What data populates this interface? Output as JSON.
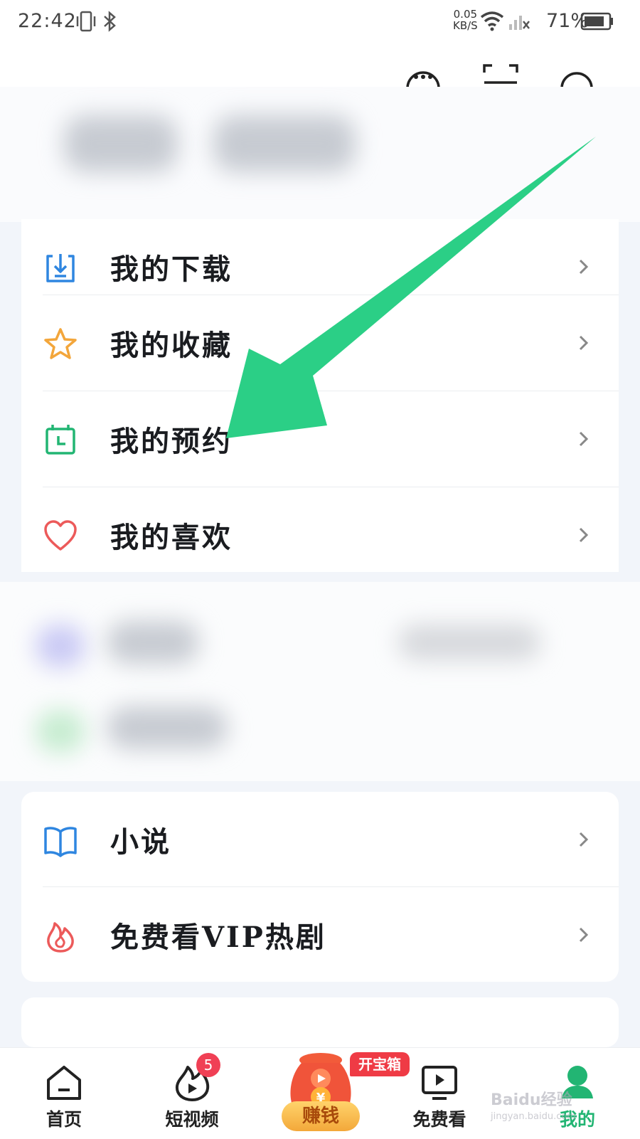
{
  "status_bar": {
    "time": "22:42",
    "net_speed_value": "0.05",
    "net_speed_unit": "KB/S",
    "battery": "71%"
  },
  "top_actions": {
    "icons": [
      "message-icon",
      "scan-icon",
      "search-icon"
    ]
  },
  "menu_card_1": {
    "items": [
      {
        "label": "我的下载",
        "icon": "download-icon",
        "color": "#2f86e0"
      },
      {
        "label": "我的收藏",
        "icon": "star-icon",
        "color": "#f3a63b"
      },
      {
        "label": "我的预约",
        "icon": "alarm-clock-icon",
        "color": "#22b573"
      },
      {
        "label": "我的喜欢",
        "icon": "heart-icon",
        "color": "#ec5a5a"
      }
    ]
  },
  "menu_card_2": {
    "items": [
      {
        "label": "小说",
        "icon": "book-icon",
        "color": "#2f86e0"
      },
      {
        "label": "免费看VIP热剧",
        "icon": "fire-icon",
        "color": "#ec5a5a"
      }
    ]
  },
  "bottom_nav": {
    "items": [
      {
        "label": "首页",
        "icon": "home-icon"
      },
      {
        "label": "短视频",
        "icon": "short-video-icon",
        "badge": "5"
      },
      {
        "label": "赚钱",
        "icon": "money-bag-icon",
        "tag": "开宝箱"
      },
      {
        "label": "免费看",
        "icon": "tv-icon"
      },
      {
        "label": "我的",
        "icon": "profile-icon",
        "active": true
      }
    ],
    "active_color": "#22b573"
  },
  "annotation": {
    "arrow_color": "#2bcf86"
  },
  "watermark": {
    "text": "Baidu经验",
    "sub": "jingyan.baidu.com"
  }
}
